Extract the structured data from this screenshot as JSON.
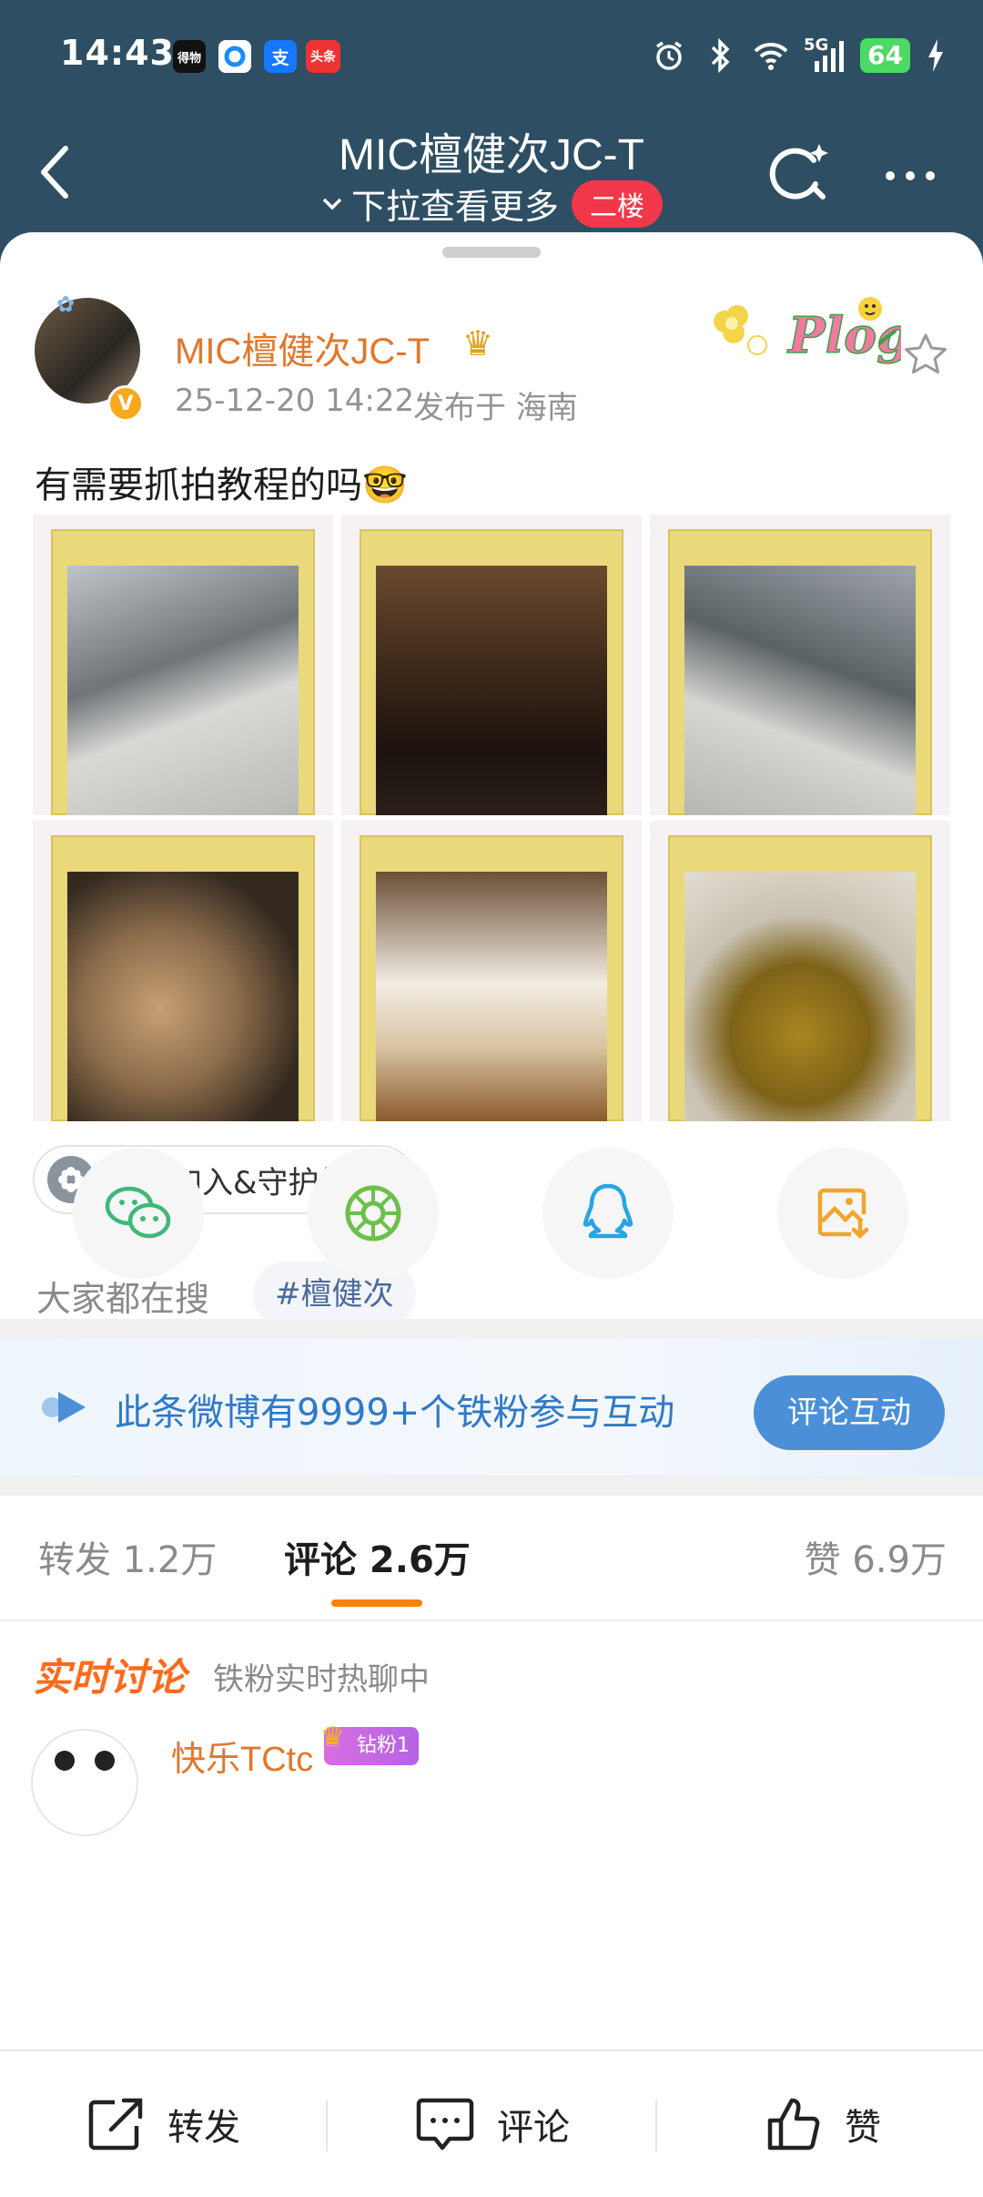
{
  "status": {
    "time": "14:43",
    "battery": "64",
    "network": "5G",
    "app_icons": [
      "得物",
      "",
      "支",
      "头条"
    ]
  },
  "header": {
    "title": "MIC檀健次JC-T",
    "subtitle": "下拉查看更多",
    "floor_badge": "二楼"
  },
  "post": {
    "author": "MIC檀健次JC-T",
    "date": "25-12-20 14:22",
    "location": "发布于 海南",
    "text": "有需要抓拍教程的吗🤓",
    "plog_label": "Plog",
    "photos": [
      "photo-1",
      "photo-2",
      "photo-3",
      "photo-4",
      "photo-5",
      "photo-6"
    ]
  },
  "join_chip": "点击加入&守护健次",
  "search": {
    "label": "大家都在搜",
    "hashtag": "#檀健次"
  },
  "share": [
    "wechat-icon",
    "moments-icon",
    "qq-icon",
    "save-image-icon"
  ],
  "interaction": {
    "text": "此条微博有9999+个铁粉参与互动",
    "button": "评论互动"
  },
  "tabs": {
    "repost": "转发 1.2万",
    "comment": "评论 2.6万",
    "like": "赞 6.9万"
  },
  "live": {
    "title": "实时讨论",
    "subtitle": "铁粉实时热聊中"
  },
  "comment": {
    "user": "快乐TCtc",
    "badge": "钻粉1"
  },
  "bottom_bar": {
    "repost": "转发",
    "comment": "评论",
    "like": "赞"
  },
  "colors": {
    "header_bg": "#2e4f63",
    "accent_orange": "#ff8200",
    "name_orange": "#e2772b",
    "link_blue": "#2f79c8",
    "badge_red": "#f0384a"
  }
}
